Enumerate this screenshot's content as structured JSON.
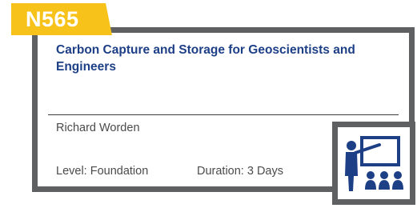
{
  "course": {
    "code": "N565",
    "title": "Carbon Capture and Storage for Geoscientists and Engineers",
    "instructor": "Richard Worden",
    "level": "Level: Foundation",
    "duration": "Duration: 3 Days"
  },
  "icons": {
    "classroom": "teacher-presentation-icon"
  },
  "colors": {
    "badge": "#f7c31b",
    "title": "#1d3f86",
    "frame": "#5f6062",
    "icon": "#1d3f86"
  }
}
